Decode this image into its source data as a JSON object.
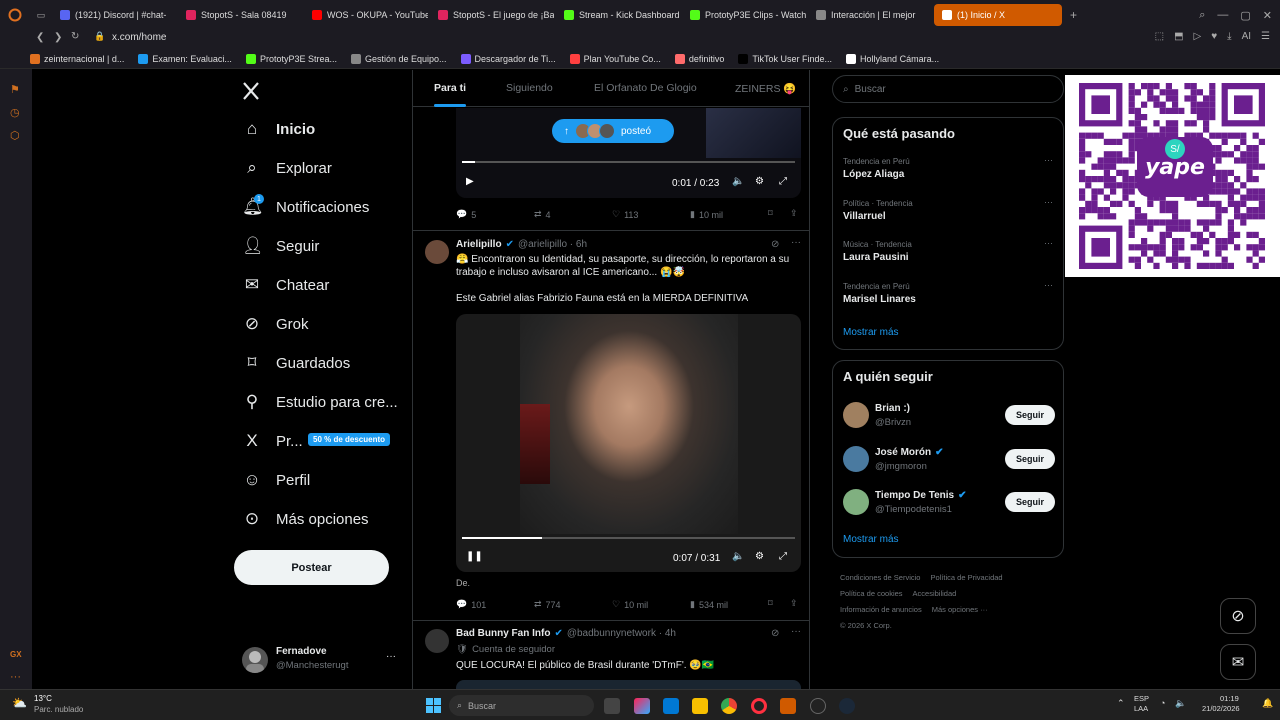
{
  "browser": {
    "tabs": [
      {
        "label": "(1921) Discord | #chat-",
        "color": "#5865f2"
      },
      {
        "label": "StopotS - Sala 08419",
        "color": "#e0245e"
      },
      {
        "label": "WOS - OKUPA - YouTube",
        "color": "#ff0000"
      },
      {
        "label": "StopotS - El juego de ¡Bas",
        "color": "#e0245e"
      },
      {
        "label": "Stream - Kick Dashboard",
        "color": "#53fc18"
      },
      {
        "label": "PrototyP3E Clips - Watch",
        "color": "#53fc18"
      },
      {
        "label": "Interacción | El mejor",
        "color": "#888888"
      },
      {
        "label": "(1) Inicio / X",
        "color": "#ffffff"
      }
    ],
    "url": "x.com/home",
    "bookmarks": [
      "zeinternacional | d...",
      "Examen: Evaluaci...",
      "PrototyP3E Strea...",
      "Gestión de Equipo...",
      "Descargador de Ti...",
      "Plan YouTube Co...",
      "definitivo",
      "TikTok User Finde...",
      "Hollyland Cámara..."
    ],
    "ai_label": "AI"
  },
  "nav": {
    "items": [
      {
        "label": "Inicio",
        "icon": "home-icon"
      },
      {
        "label": "Explorar",
        "icon": "search-icon"
      },
      {
        "label": "Notificaciones",
        "icon": "bell-icon",
        "badge": "1"
      },
      {
        "label": "Seguir",
        "icon": "follow-icon"
      },
      {
        "label": "Chatear",
        "icon": "mail-icon"
      },
      {
        "label": "Grok",
        "icon": "grok-icon"
      },
      {
        "label": "Guardados",
        "icon": "bookmark-icon"
      },
      {
        "label": "Estudio para cre...",
        "icon": "creator-icon"
      },
      {
        "label": "Pr...",
        "icon": "x-premium-icon"
      },
      {
        "label": "Perfil",
        "icon": "person-icon"
      },
      {
        "label": "Más opciones",
        "icon": "more-icon"
      }
    ],
    "premium_badge": "50 % de descuento",
    "post_button": "Postear",
    "account_name": "Fernadove",
    "account_handle": "@Manchesterugt",
    "account_more": "···"
  },
  "feed": {
    "tabs": [
      "Para ti",
      "Siguiendo",
      "El Orfanato De Glogio",
      "ZEINERS 😝"
    ],
    "posted_pill": "posteó",
    "post1": {
      "time": "0:01 / 0:23",
      "replies": "5",
      "reposts": "4",
      "likes": "113",
      "views": "10 mil",
      "progress": 0.04
    },
    "post2": {
      "name": "Arielipillo",
      "handle": "@arielipillo · 6h",
      "text1": "😤 Encontraron su Identidad, su pasaporte, su dirección, lo reportaron a su trabajo e incluso avisaron al ICE americano... 😭🤯",
      "text2": "Este Gabriel alias Fabrizio Fauna está en la MIERDA DEFINITIVA",
      "time": "0:07 / 0:31",
      "progress": 0.24,
      "caption": "De.",
      "replies": "101",
      "reposts": "774",
      "likes": "10 mil",
      "views": "534 mil"
    },
    "post3": {
      "name": "Bad Bunny Fan Info",
      "handle": "@badbunnynetwork · 4h",
      "follow_note": "Cuenta de seguidor",
      "text": "QUE LOCURA! El público de Brasil durante 'DTmF'. 🥹🇧🇷"
    }
  },
  "right": {
    "search_placeholder": "Buscar",
    "trends_title": "Qué está pasando",
    "trends": [
      {
        "meta": "Tendencia en Perú",
        "name": "López Aliaga"
      },
      {
        "meta": "Política · Tendencia",
        "name": "Villarruel"
      },
      {
        "meta": "Música · Tendencia",
        "name": "Laura Pausini"
      },
      {
        "meta": "Tendencia en Perú",
        "name": "Marisel Linares"
      }
    ],
    "show_more": "Mostrar más",
    "who_title": "A quién seguir",
    "who": [
      {
        "name": "Brian :)",
        "handle": "@Brivzn",
        "verified": false
      },
      {
        "name": "José Morón",
        "handle": "@jmgmoron",
        "verified": true
      },
      {
        "name": "Tiempo De Tenis",
        "handle": "@Tiempodetenis1",
        "verified": true
      }
    ],
    "follow_label": "Seguir",
    "footer": [
      "Condiciones de Servicio",
      "Política de Privacidad",
      "Política de cookies",
      "Accesibilidad",
      "Información de anuncios",
      "Más opciones ···",
      "© 2026 X Corp."
    ]
  },
  "overlay": {
    "qr_brand": "yape"
  },
  "taskbar": {
    "weather_temp": "13°C",
    "weather_desc": "Parc. nublado",
    "search_placeholder": "Buscar",
    "lang": "ESP",
    "lang2": "LAA",
    "time": "01:19",
    "date": "21/02/2026"
  },
  "colors": {
    "accent": "#1d9bf0",
    "brand_opera": "#d05a00",
    "yape": "#6b1f8f"
  }
}
